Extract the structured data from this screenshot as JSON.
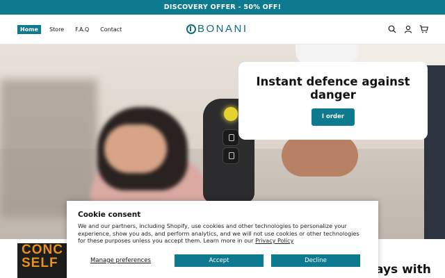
{
  "announcement": "DISCOVERY OFFER - 50% OFF!",
  "nav": {
    "items": [
      "Home",
      "Store",
      "F.A.Q",
      "Contact"
    ]
  },
  "logo": "BONANI",
  "icons": {
    "search": "search-icon",
    "account": "user-icon",
    "cart": "cart-icon"
  },
  "hero": {
    "title": "Instant defence against danger",
    "button": "I order"
  },
  "below": {
    "thumb_lines": [
      "CONC",
      "SELF"
    ],
    "heading": "ays with"
  },
  "cookie": {
    "title": "Cookie consent",
    "text": "We and our partners, including Shopify, use cookies and other technologies to personalize your experience, show you ads, and perform analytics, and we will not use cookies or other technologies for these purposes unless you accept them. Learn more in our ",
    "policy_link": "Privacy Policy",
    "manage": "Manage preferences",
    "accept": "Accept",
    "decline": "Decline"
  },
  "colors": {
    "accent": "#0e7a8f",
    "logo": "#0e6b80",
    "text": "#121212"
  }
}
